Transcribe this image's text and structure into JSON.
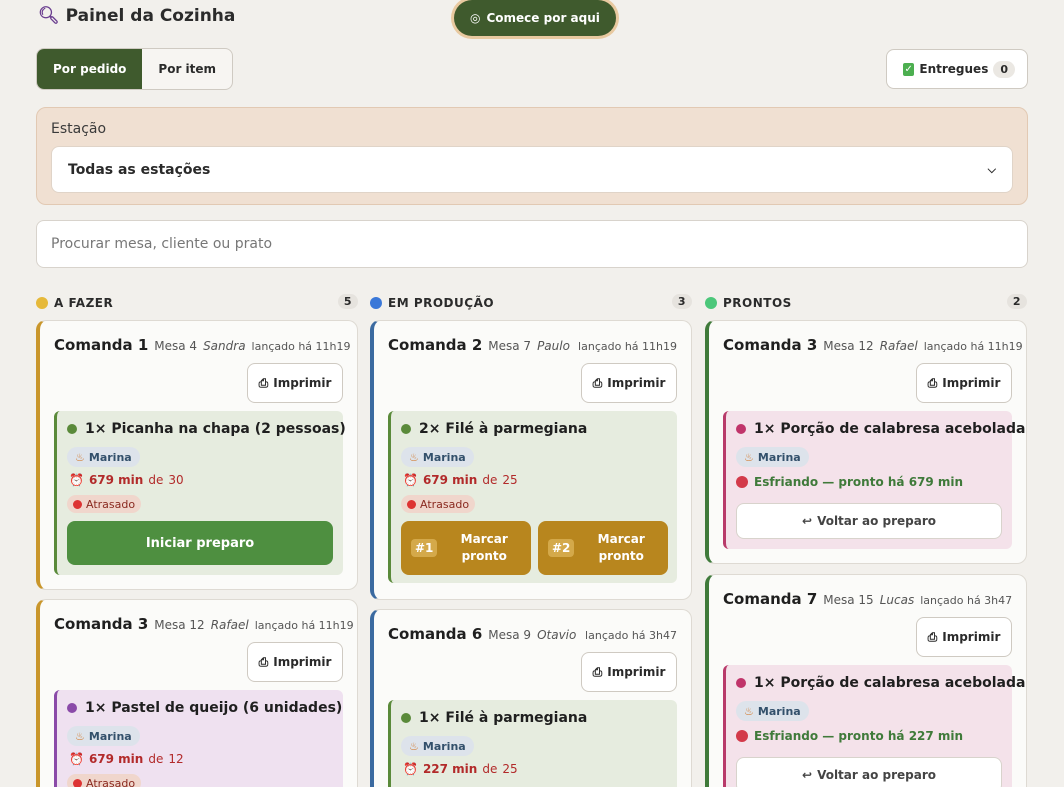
{
  "header": {
    "title": "Painel da Cozinha",
    "start_label": "Comece por aqui"
  },
  "view_toggle": {
    "by_order": "Por pedido",
    "by_item": "Por item"
  },
  "delivered": {
    "label": "Entregues",
    "count": "0"
  },
  "station": {
    "label": "Estação",
    "selected": "Todas as estações"
  },
  "search": {
    "placeholder": "Procurar mesa, cliente ou prato"
  },
  "common": {
    "print": "Imprimir",
    "chef": "Marina",
    "late": "Atrasado",
    "start": "Iniciar preparo",
    "mark": "Marcar pronto",
    "back": "Voltar ao preparo",
    "de": "de"
  },
  "columns": [
    {
      "title": "A FAZER",
      "count": "5",
      "color": "#e6b93a"
    },
    {
      "title": "EM PRODUÇÃO",
      "count": "3",
      "color": "#3b78d8"
    },
    {
      "title": "PRONTOS",
      "count": "2",
      "color": "#4cc77a"
    }
  ],
  "todo": [
    {
      "cmd": "Comanda 1",
      "mesa": "Mesa 4",
      "client": "Sandra",
      "time": "lançado há 11h19",
      "item": "1× Picanha na chapa (2 pessoas)",
      "elapsed": "679 min",
      "target": "30"
    },
    {
      "cmd": "Comanda 3",
      "mesa": "Mesa 12",
      "client": "Rafael",
      "time": "lançado há 11h19",
      "item": "1× Pastel de queijo (6 unidades)",
      "elapsed": "679 min",
      "target": "12"
    }
  ],
  "prod": [
    {
      "cmd": "Comanda 2",
      "mesa": "Mesa 7",
      "client": "Paulo",
      "time": "lançado há 11h19",
      "item": "2× Filé à parmegiana",
      "elapsed": "679 min",
      "target": "25",
      "tag1": "#1",
      "tag2": "#2"
    },
    {
      "cmd": "Comanda 6",
      "mesa": "Mesa 9",
      "client": "Otavio",
      "time": "lançado há 3h47",
      "item": "1× Filé à parmegiana",
      "elapsed": "227 min",
      "target": "25"
    }
  ],
  "done": [
    {
      "cmd": "Comanda 3",
      "mesa": "Mesa 12",
      "client": "Rafael",
      "time": "lançado há 11h19",
      "item": "1× Porção de calabresa acebolada",
      "status": "Esfriando — pronto há 679 min"
    },
    {
      "cmd": "Comanda 7",
      "mesa": "Mesa 15",
      "client": "Lucas",
      "time": "lançado há 3h47",
      "item": "1× Porção de calabresa acebolada",
      "status": "Esfriando — pronto há 227 min"
    }
  ]
}
